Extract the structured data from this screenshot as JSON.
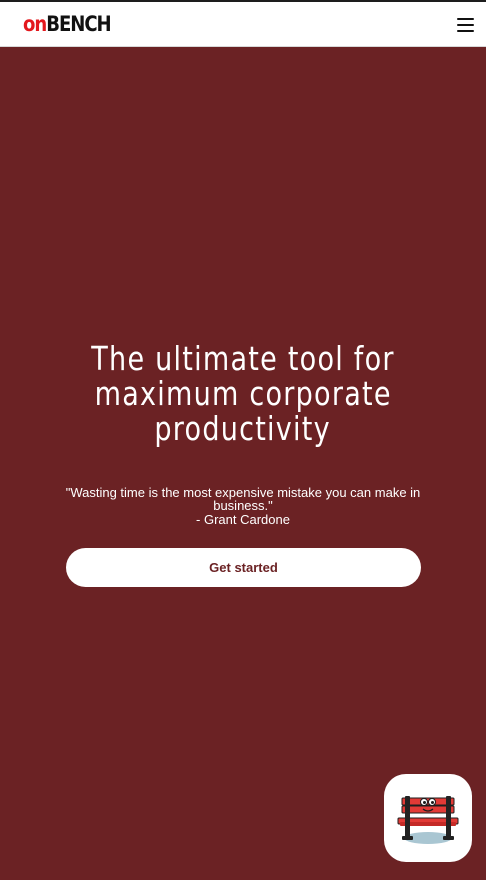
{
  "header": {
    "logo_prefix": "on",
    "logo_suffix": "BENCH",
    "menu_icon": "hamburger-menu-icon"
  },
  "hero": {
    "title_line1": "The ultimate tool for",
    "title_line2": "maximum corporate",
    "title_line3": "productivity",
    "quote": "\"Wasting time is the most expensive mistake you can make in business.\"",
    "author": "- Grant Cardone",
    "cta_label": "Get started"
  },
  "floating_app_icon": "bench-mascot-icon",
  "colors": {
    "background": "#6b2224",
    "logo_accent": "#e3181d",
    "cta_text": "#6b2224",
    "navbar": "#ffffff"
  }
}
